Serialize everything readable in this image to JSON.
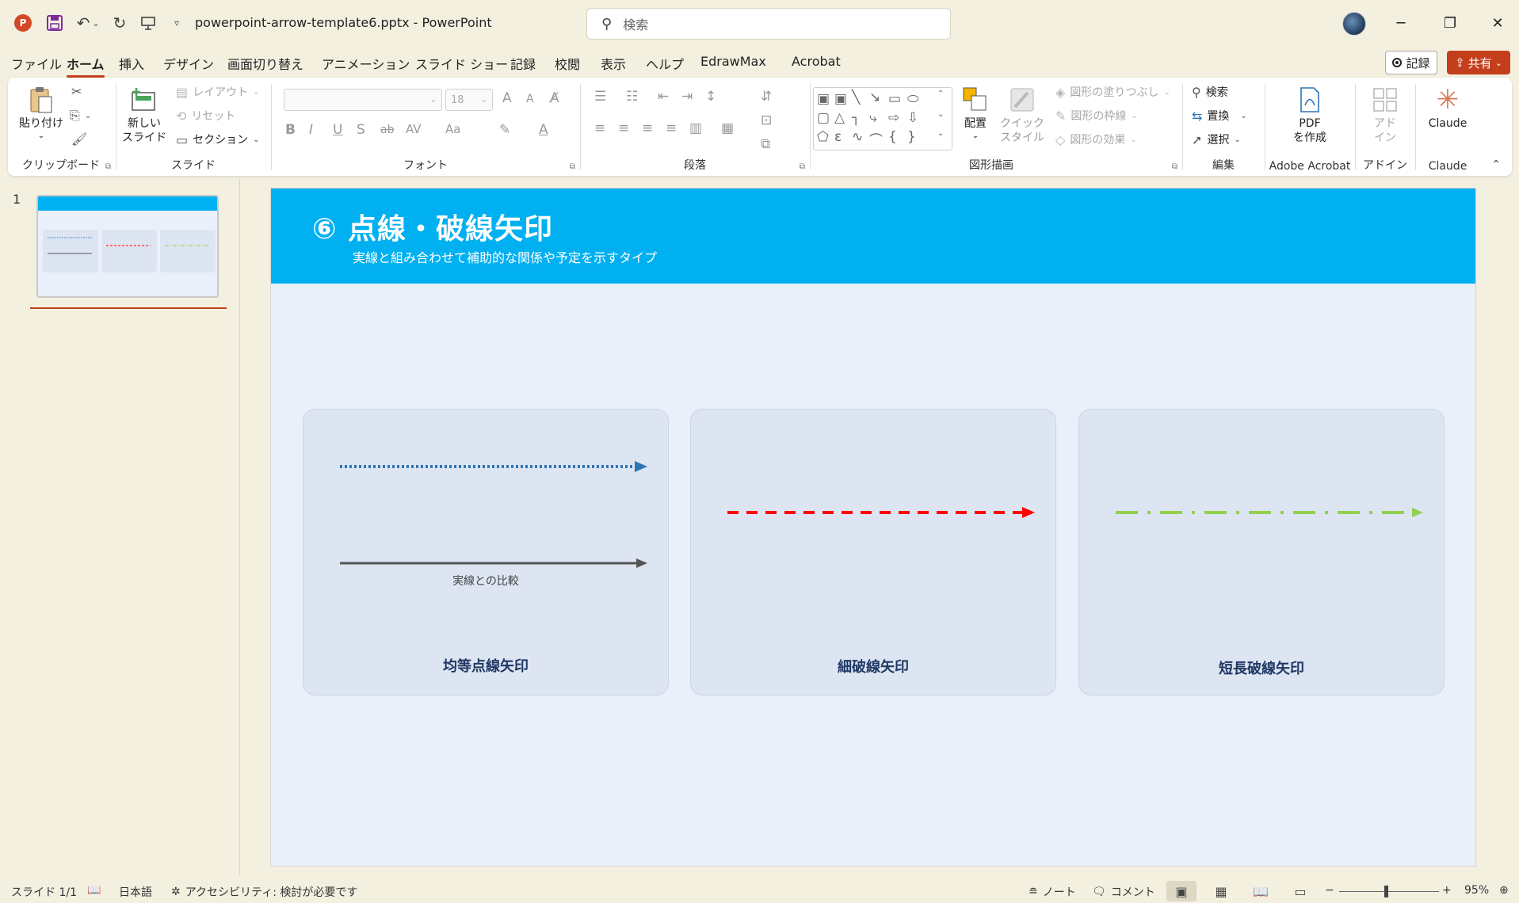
{
  "app": {
    "logo_letter": "P",
    "file_title": "powerpoint-arrow-template6.pptx  -  PowerPoint",
    "search_placeholder": "検索"
  },
  "quick_access": {
    "icons": [
      "save-icon",
      "undo-icon",
      "redo-icon",
      "present-icon",
      "customize-icon"
    ]
  },
  "window_controls": {
    "minimize": "─",
    "restore": "❐",
    "close": "✕"
  },
  "menu": {
    "tabs": [
      "ファイル",
      "ホーム",
      "挿入",
      "デザイン",
      "画面切り替え",
      "アニメーション",
      "スライド ショー",
      "記録",
      "校閲",
      "表示",
      "ヘルプ",
      "EdrawMax",
      "Acrobat"
    ],
    "active_tab": "ホーム",
    "record_label": "記録",
    "share_label": "共有"
  },
  "ribbon": {
    "clipboard": {
      "paste": "貼り付け",
      "label": "クリップボード"
    },
    "slides": {
      "new_slide_1": "新しい",
      "new_slide_2": "スライド",
      "layout": "レイアウト",
      "reset": "リセット",
      "section": "セクション",
      "label": "スライド"
    },
    "font": {
      "size": "18",
      "label": "フォント",
      "bold": "B",
      "italic": "I",
      "underline": "U",
      "shadow": "S",
      "strike": "ab",
      "spacing": "AV",
      "case": "Aa",
      "grow": "A",
      "shrink": "A"
    },
    "paragraph": {
      "label": "段落"
    },
    "drawing": {
      "arrange": "配置",
      "quick_style_1": "クイック",
      "quick_style_2": "スタイル",
      "fill": "図形の塗りつぶし",
      "outline": "図形の枠線",
      "effects": "図形の効果",
      "label": "図形描画"
    },
    "editing": {
      "find": "検索",
      "replace": "置換",
      "select": "選択",
      "label": "編集"
    },
    "acrobat": {
      "pdf_1": "PDF",
      "pdf_2": "を作成",
      "label": "Adobe Acrobat"
    },
    "addins": {
      "addin_1": "アド",
      "addin_2": "イン",
      "label": "アドイン"
    },
    "claude": {
      "name": "Claude",
      "label": "Claude"
    }
  },
  "thumbnails": {
    "slide_number": "1"
  },
  "slide": {
    "title": "⑥ 点線・破線矢印",
    "subtitle": "実線と組み合わせて補助的な関係や予定を示すタイプ",
    "cards": [
      {
        "label": "均等点線矢印",
        "note": "実線との比較",
        "color": "#2e75b6",
        "compare_color": "#555555"
      },
      {
        "label": "細破線矢印",
        "color": "#ff0000"
      },
      {
        "label": "短長破線矢印",
        "color": "#92d050"
      }
    ],
    "header_color": "#00b0f0",
    "background_color": "#eaf0f9"
  },
  "statusbar": {
    "slide_info": "スライド 1/1",
    "language": "日本語",
    "accessibility": "アクセシビリティ: 検討が必要です",
    "notes": "ノート",
    "comments": "コメント",
    "zoom_minus": "−",
    "zoom_plus": "+",
    "zoom": "95%"
  }
}
